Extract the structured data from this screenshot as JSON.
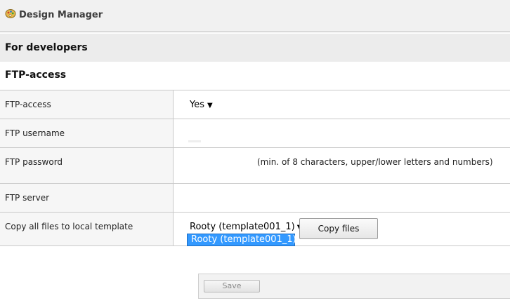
{
  "app": {
    "title": "Design Manager",
    "icon": "palette-icon"
  },
  "section": {
    "title": "For developers"
  },
  "subsection": {
    "title": "FTP-access"
  },
  "form": {
    "ftp_access": {
      "label": "FTP-access",
      "value": "Yes"
    },
    "ftp_username": {
      "label": "FTP username",
      "value": ""
    },
    "ftp_password": {
      "label": "FTP password",
      "value": "",
      "hint": "(min. of 8 characters, upper/lower letters and numbers)"
    },
    "ftp_server": {
      "label": "FTP server",
      "value": ""
    },
    "copy_files": {
      "label": "Copy all files to local template",
      "selected": "Rooty (template001_1)",
      "options": [
        "Rooty (template001_1)"
      ],
      "button_label": "Copy files"
    }
  },
  "save": {
    "label": "Save"
  },
  "colors": {
    "highlight": "#3399ff",
    "header_bg": "#ececec"
  }
}
